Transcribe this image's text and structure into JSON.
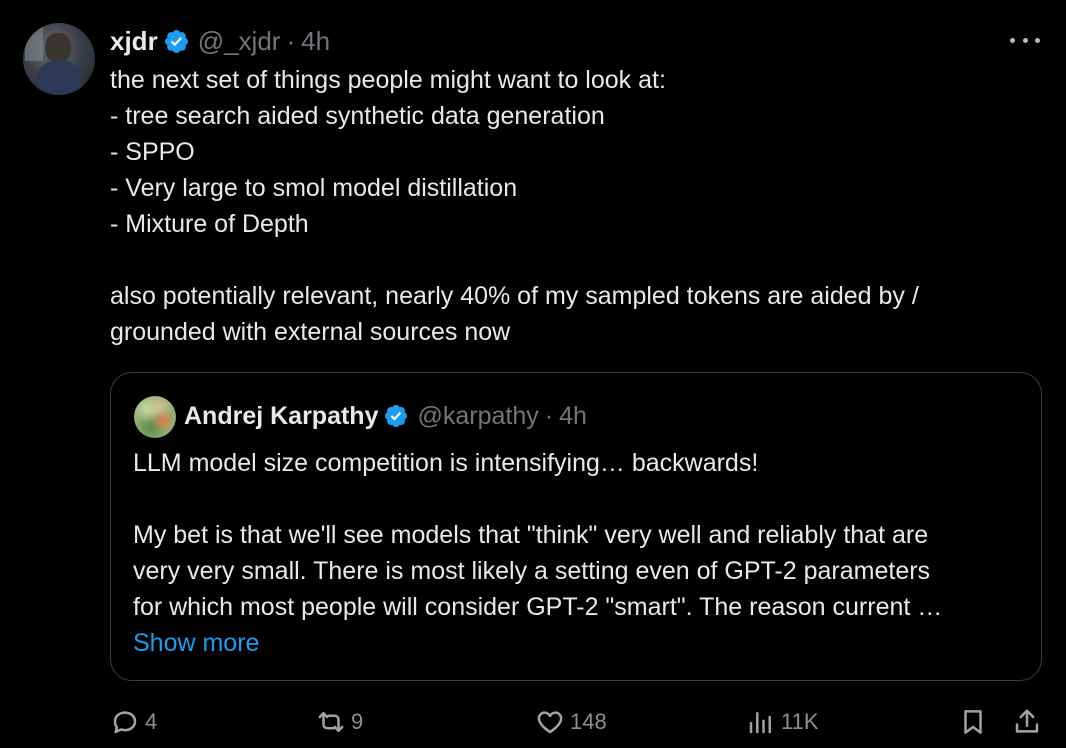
{
  "tweet": {
    "author": {
      "display_name": "xjdr",
      "handle": "@_xjdr",
      "separator": "·",
      "time": "4h",
      "verified": true
    },
    "text_lines": [
      "the next set of things people might want to look at:",
      "- tree search aided synthetic data generation",
      "- SPPO",
      "- Very large to smol model distillation",
      "- Mixture of Depth",
      "",
      "also potentially relevant, nearly 40% of my sampled tokens are aided by /",
      "grounded with external sources now"
    ],
    "quote": {
      "author": {
        "display_name": "Andrej Karpathy",
        "handle": "@karpathy",
        "separator": "·",
        "time": "4h",
        "verified": true
      },
      "text_lines": [
        "LLM model size competition is intensifying… backwards!",
        "",
        "My bet is that we'll see models that \"think\" very well and reliably that are",
        "very very small. There is most likely a setting even of GPT-2 parameters",
        "for which most people will consider GPT-2 \"smart\". The reason current …"
      ],
      "show_more_label": "Show more"
    },
    "actions": {
      "reply_count": "4",
      "repost_count": "9",
      "like_count": "148",
      "views_count": "11K"
    }
  },
  "icons": {
    "more": "more-horizontal-icon",
    "verified": "verified-badge-icon",
    "reply": "reply-icon",
    "repost": "repost-icon",
    "like": "heart-icon",
    "views": "analytics-icon",
    "bookmark": "bookmark-icon",
    "share": "share-icon"
  },
  "colors": {
    "background": "#000000",
    "text": "#e7e9ea",
    "secondary": "#71767b",
    "accent": "#1d9bf0",
    "border": "#3a3d41"
  }
}
